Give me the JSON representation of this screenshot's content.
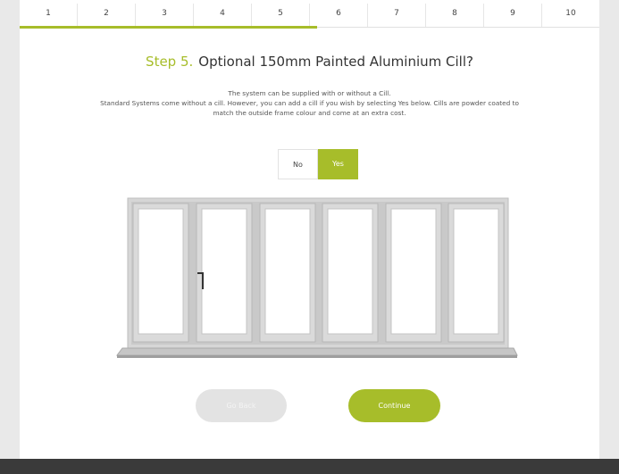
{
  "steps": [
    "1",
    "2",
    "3",
    "4",
    "5",
    "6",
    "7",
    "8",
    "9",
    "10"
  ],
  "progress_fraction": 0.5,
  "heading": {
    "step_label": "Step 5.",
    "title": "Optional 150mm Painted Aluminium Cill?"
  },
  "description": {
    "line1": "The system can be supplied with or without a Cill.",
    "line2": "Standard Systems come without a cill. However, you can add a cill if you wish by selecting Yes below. Cills are powder coated to",
    "line3": "match the outside frame colour and come at an extra cost."
  },
  "toggle": {
    "no_label": "No",
    "yes_label": "Yes",
    "selected": "Yes"
  },
  "buttons": {
    "back_label": "Go Back",
    "continue_label": "Continue"
  },
  "colors": {
    "accent": "#a7bd2a",
    "footer": "#3a3a3a",
    "frame": "#cfcfcf"
  },
  "illustration": {
    "door_panels": 6,
    "cill": true
  }
}
